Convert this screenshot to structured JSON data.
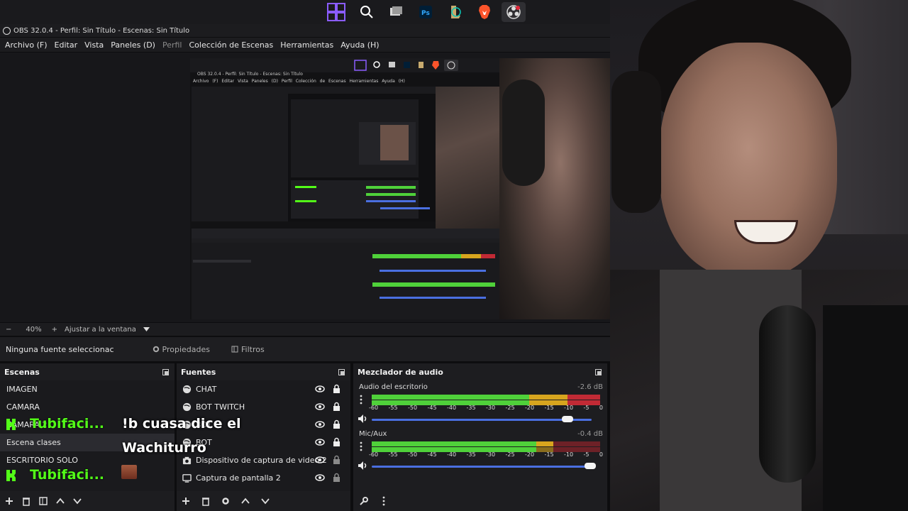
{
  "obs": {
    "title": "OBS 32.0.4 - Perfil: Sin Título - Escenas: Sin Título",
    "menu": [
      {
        "label": "Archivo (F)",
        "disabled": false
      },
      {
        "label": "Editar",
        "disabled": false
      },
      {
        "label": "Vista",
        "disabled": false
      },
      {
        "label": "Paneles (D)",
        "disabled": false
      },
      {
        "label": "Perfil",
        "disabled": true
      },
      {
        "label": "Colección de Escenas",
        "disabled": false
      },
      {
        "label": "Herramientas",
        "disabled": false
      },
      {
        "label": "Ayuda (H)",
        "disabled": false
      }
    ],
    "nested": {
      "title": "OBS 32.0.4 - Perfil: Sin Título - Escenas: Sin Título",
      "menu": "Archivo (F)  Editar  Vista  Paneles (D)  Perfil  Colección de Escenas  Herramientas  Ayuda (H)"
    },
    "zoom": {
      "minus": "−",
      "value": "40%",
      "plus": "+",
      "fit_label": "Ajustar a la ventana"
    },
    "context": {
      "no_source": "Ninguna fuente seleccionac",
      "properties": "Propiedades",
      "filters": "Filtros"
    },
    "scenes": {
      "title": "Escenas",
      "items": [
        "IMAGEN",
        "CAMARA",
        "CAMARA 2",
        "Escena clases",
        "ESCRITORIO SOLO"
      ],
      "selected_index": 3
    },
    "sources": {
      "title": "Fuentes",
      "items": [
        {
          "label": "CHAT",
          "icon": "globe-icon"
        },
        {
          "label": "BOT TWITCH",
          "icon": "globe-icon"
        },
        {
          "label": "BOT",
          "icon": "globe-icon"
        },
        {
          "label": "BOT",
          "icon": "globe-icon"
        },
        {
          "label": "Dispositivo de captura de video 2",
          "icon": "camera-icon"
        },
        {
          "label": "Captura de pantalla 2",
          "icon": "monitor-icon"
        }
      ]
    },
    "mixer": {
      "title": "Mezclador de audio",
      "ticks": [
        "-60",
        "-55",
        "-50",
        "-45",
        "-40",
        "-35",
        "-30",
        "-25",
        "-20",
        "-15",
        "-10",
        "-5",
        "0"
      ],
      "channels": [
        {
          "name": "Audio del escritorio",
          "db": "-2.6 dB",
          "volume": 0.93
        },
        {
          "name": "Mic/Aux",
          "db": "-0.4 dB",
          "volume": 0.99
        }
      ]
    }
  },
  "chat_overlay": {
    "user1": "Tubifaci...",
    "message1a": "!b cuasa dice el",
    "message1b": "Wachiturro",
    "user2": "Tubifaci..."
  },
  "colors": {
    "kick_green": "#53fc18",
    "meter_green": "#4fd13a",
    "meter_yellow": "#d7a51e",
    "meter_red": "#c12a35",
    "volume_blue": "#4a6fe0"
  }
}
